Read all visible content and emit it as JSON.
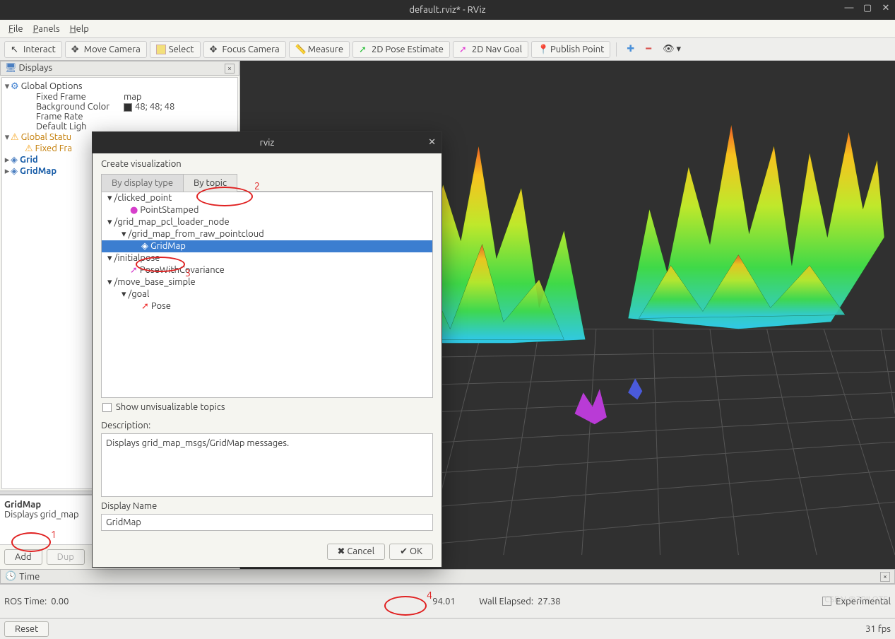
{
  "window": {
    "title": "default.rviz* - RViz"
  },
  "menubar": {
    "file": "File",
    "panels": "Panels",
    "help": "Help"
  },
  "toolbar": {
    "interact": "Interact",
    "move_camera": "Move Camera",
    "select": "Select",
    "focus_camera": "Focus Camera",
    "measure": "Measure",
    "pose_estimate": "2D Pose Estimate",
    "nav_goal": "2D Nav Goal",
    "publish_point": "Publish Point"
  },
  "displays_panel": {
    "title": "Displays",
    "tree": {
      "global_options": "Global Options",
      "fixed_frame_k": "Fixed Frame",
      "fixed_frame_v": "map",
      "bg_color_k": "Background Color",
      "bg_color_v": "48; 48; 48",
      "frame_rate_k": "Frame Rate",
      "default_light_k": "Default Ligh",
      "global_status": "Global Statu",
      "fixed_frame_status": "Fixed Fra",
      "grid": "Grid",
      "gridmap": "GridMap"
    },
    "desc": {
      "hd": "GridMap",
      "body": "Displays grid_map"
    },
    "buttons": {
      "add": "Add",
      "dup": "Dup"
    }
  },
  "dialog": {
    "title": "rviz",
    "heading": "Create visualization",
    "tab_bytype": "By display type",
    "tab_bytopic": "By topic",
    "tree": {
      "clicked_point": "/clicked_point",
      "point_stamped": "PointStamped",
      "pcl_node": "/grid_map_pcl_loader_node",
      "from_raw": "/grid_map_from_raw_pointcloud",
      "gridmap": "GridMap",
      "initialpose": "/initialpose",
      "posewithcov": "PoseWithCovariance",
      "move_base": "/move_base_simple",
      "goal": "/goal",
      "pose": "Pose"
    },
    "show_unviz": "Show unvisualizable topics",
    "desc_label": "Description:",
    "desc_text": "Displays grid_map_msgs/GridMap messages.",
    "name_label": "Display Name",
    "name_value": "GridMap",
    "cancel": "Cancel",
    "ok": "OK"
  },
  "time": {
    "panel_title": "Time",
    "ros_time_label": "ROS Time:",
    "ros_time": "0.00",
    "wall_time_partial": "94.01",
    "wall_elapsed_label": "Wall Elapsed:",
    "wall_elapsed": "27.38",
    "experimental": "Experimental",
    "reset": "Reset",
    "fps": "31 fps"
  },
  "annotations": {
    "n1": "1",
    "n2": "2",
    "n3": "3",
    "n4": "4"
  },
  "watermark": "CSDN @ZPILOTE"
}
